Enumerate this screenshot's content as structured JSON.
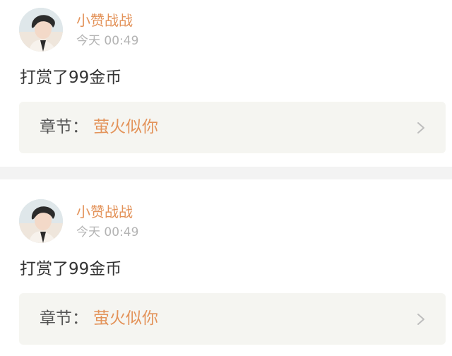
{
  "entries": [
    {
      "username": "小赞战战",
      "time": "今天 00:49",
      "content": "打赏了99金币",
      "chapter_prefix": "章节：",
      "chapter_title": "萤火似你"
    },
    {
      "username": "小赞战战",
      "time": "今天 00:49",
      "content": "打赏了99金币",
      "chapter_prefix": "章节：",
      "chapter_title": "萤火似你"
    }
  ],
  "icons": {
    "chapter_arrow": "chevron-right-icon"
  },
  "colors": {
    "accent": "#e3935a",
    "text": "#333333",
    "muted": "#b3b3b3",
    "box_bg": "#f5f5f1"
  }
}
